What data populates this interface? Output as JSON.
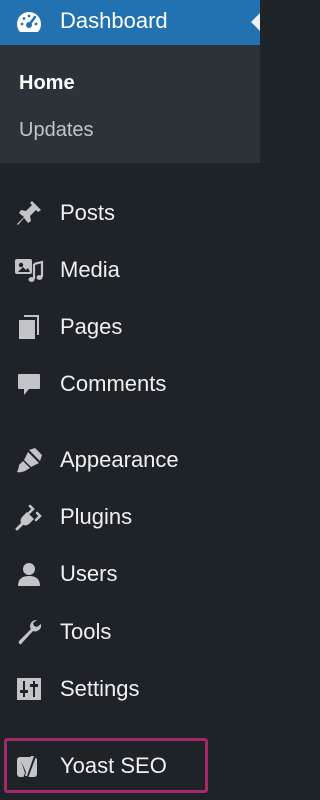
{
  "menu": {
    "dashboard": {
      "label": "Dashboard",
      "icon": "dashboard-gauge-icon"
    },
    "submenu": [
      {
        "label": "Home"
      },
      {
        "label": "Updates"
      }
    ],
    "items": [
      {
        "label": "Posts",
        "icon": "pushpin-icon"
      },
      {
        "label": "Media",
        "icon": "media-icon"
      },
      {
        "label": "Pages",
        "icon": "pages-icon"
      },
      {
        "label": "Comments",
        "icon": "comment-bubble-icon"
      },
      {
        "label": "Appearance",
        "icon": "paintbrush-icon"
      },
      {
        "label": "Plugins",
        "icon": "plug-icon"
      },
      {
        "label": "Users",
        "icon": "user-icon"
      },
      {
        "label": "Tools",
        "icon": "wrench-icon"
      },
      {
        "label": "Settings",
        "icon": "sliders-icon"
      },
      {
        "label": "Yoast SEO",
        "icon": "yoast-logo-icon"
      }
    ]
  },
  "colors": {
    "sidebar_bg": "#1d2327",
    "submenu_bg": "#2c3338",
    "active_bg": "#2271b1",
    "text": "#f0f0f1",
    "icon": "#c3c4c7",
    "highlight_border": "#a4286a"
  }
}
